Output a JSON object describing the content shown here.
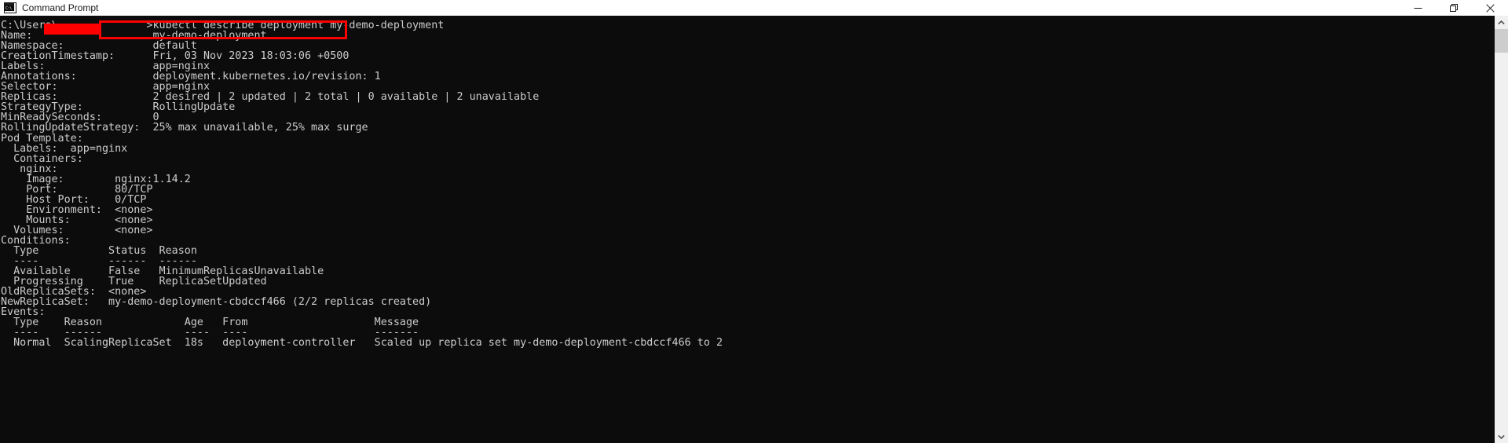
{
  "window": {
    "title": "Command Prompt",
    "icon": "command-prompt-icon",
    "icon_prompt_text": "C:\\",
    "controls": {
      "minimize_label": "Minimize",
      "maximize_label": "Restore",
      "close_label": "Close"
    }
  },
  "colors": {
    "titlebar_background": "#ffffff",
    "titlebar_text": "#1a1a1a",
    "console_background": "#0c0c0c",
    "console_text": "#cccccc",
    "annotation_red": "#ff0000",
    "scrollbar_track": "#f0f0f0",
    "scrollbar_thumb": "#cdcdcd"
  },
  "annotations": {
    "redaction_label": "username-redaction-block",
    "highlight_label": "command-highlight-box"
  },
  "scrollbar": {
    "up_arrow": "scroll-up-arrow",
    "down_arrow": "scroll-down-arrow",
    "thumb": "scroll-thumb"
  },
  "terminal": {
    "prompt_prefix": "C:\\Users\\",
    "prompt_suffix": ">",
    "command": "kubectl describe deployment my-demo-deployment",
    "lines": [
      "C:\\Users\\              >kubectl describe deployment my-demo-deployment",
      "Name:                   my-demo-deployment",
      "Namespace:              default",
      "CreationTimestamp:      Fri, 03 Nov 2023 18:03:06 +0500",
      "Labels:                 app=nginx",
      "Annotations:            deployment.kubernetes.io/revision: 1",
      "Selector:               app=nginx",
      "Replicas:               2 desired | 2 updated | 2 total | 0 available | 2 unavailable",
      "StrategyType:           RollingUpdate",
      "MinReadySeconds:        0",
      "RollingUpdateStrategy:  25% max unavailable, 25% max surge",
      "Pod Template:",
      "  Labels:  app=nginx",
      "  Containers:",
      "   nginx:",
      "    Image:        nginx:1.14.2",
      "    Port:         80/TCP",
      "    Host Port:    0/TCP",
      "    Environment:  <none>",
      "    Mounts:       <none>",
      "  Volumes:        <none>",
      "Conditions:",
      "  Type           Status  Reason",
      "  ----           ------  ------",
      "  Available      False   MinimumReplicasUnavailable",
      "  Progressing    True    ReplicaSetUpdated",
      "OldReplicaSets:  <none>",
      "NewReplicaSet:   my-demo-deployment-cbdccf466 (2/2 replicas created)",
      "Events:",
      "  Type    Reason             Age   From                    Message",
      "  ----    ------             ----  ----                    -------",
      "  Normal  ScalingReplicaSet  18s   deployment-controller   Scaled up replica set my-demo-deployment-cbdccf466 to 2"
    ],
    "fields": {
      "name": "my-demo-deployment",
      "namespace": "default",
      "creation_timestamp": "Fri, 03 Nov 2023 18:03:06 +0500",
      "labels": "app=nginx",
      "annotations": "deployment.kubernetes.io/revision: 1",
      "selector": "app=nginx",
      "replicas": "2 desired | 2 updated | 2 total | 0 available | 2 unavailable",
      "strategy_type": "RollingUpdate",
      "min_ready_seconds": "0",
      "rolling_update_strategy": "25% max unavailable, 25% max surge",
      "pod_template_labels": "app=nginx",
      "container_name": "nginx",
      "image": "nginx:1.14.2",
      "port": "80/TCP",
      "host_port": "0/TCP",
      "environment": "<none>",
      "mounts": "<none>",
      "volumes": "<none>",
      "old_replica_sets": "<none>",
      "new_replica_set": "my-demo-deployment-cbdccf466 (2/2 replicas created)"
    },
    "conditions": {
      "headers": [
        "Type",
        "Status",
        "Reason"
      ],
      "rows": [
        [
          "Available",
          "False",
          "MinimumReplicasUnavailable"
        ],
        [
          "Progressing",
          "True",
          "ReplicaSetUpdated"
        ]
      ]
    },
    "events": {
      "headers": [
        "Type",
        "Reason",
        "Age",
        "From",
        "Message"
      ],
      "rows": [
        [
          "Normal",
          "ScalingReplicaSet",
          "18s",
          "deployment-controller",
          "Scaled up replica set my-demo-deployment-cbdccf466 to 2"
        ]
      ]
    }
  }
}
